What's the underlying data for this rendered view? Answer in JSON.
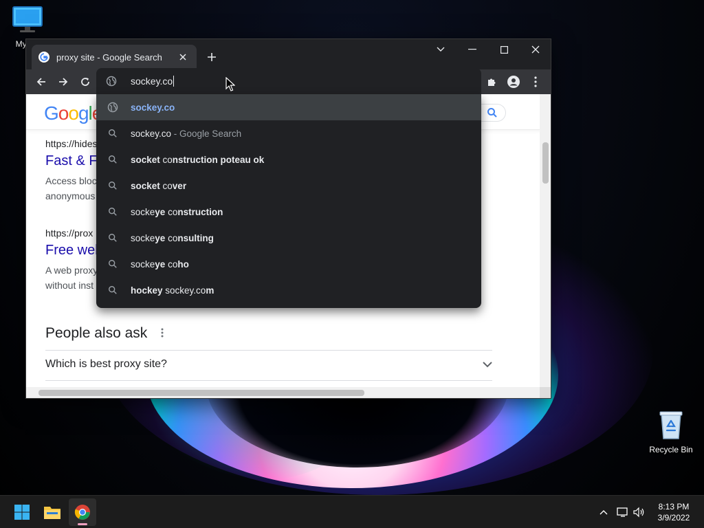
{
  "desktop": {
    "icons": [
      {
        "label": "My Co"
      },
      {
        "label": "Recycle Bin"
      }
    ]
  },
  "browser": {
    "tab": {
      "title": "proxy site - Google Search"
    },
    "omnibox": {
      "typed": "sockey.co"
    },
    "suggestions": [
      {
        "type": "url",
        "parts": [
          {
            "text": "sockey.co",
            "style": "link"
          }
        ]
      },
      {
        "type": "search",
        "parts": [
          {
            "text": "sockey.co",
            "style": "plain"
          },
          {
            "text": " - Google Search",
            "style": "dim"
          }
        ]
      },
      {
        "type": "search",
        "parts": [
          {
            "text": "socket",
            "style": "bold"
          },
          {
            "text": " co",
            "style": "plain"
          },
          {
            "text": "nstruction poteau ok",
            "style": "bold"
          }
        ]
      },
      {
        "type": "search",
        "parts": [
          {
            "text": "socket",
            "style": "bold"
          },
          {
            "text": " co",
            "style": "plain"
          },
          {
            "text": "ver",
            "style": "bold"
          }
        ]
      },
      {
        "type": "search",
        "parts": [
          {
            "text": "socke",
            "style": "plain"
          },
          {
            "text": "ye",
            "style": "bold"
          },
          {
            "text": " co",
            "style": "plain"
          },
          {
            "text": "nstruction",
            "style": "bold"
          }
        ]
      },
      {
        "type": "search",
        "parts": [
          {
            "text": "socke",
            "style": "plain"
          },
          {
            "text": "ye",
            "style": "bold"
          },
          {
            "text": " co",
            "style": "plain"
          },
          {
            "text": "nsulting",
            "style": "bold"
          }
        ]
      },
      {
        "type": "search",
        "parts": [
          {
            "text": "socke",
            "style": "plain"
          },
          {
            "text": "ye",
            "style": "bold"
          },
          {
            "text": " co",
            "style": "plain"
          },
          {
            "text": "ho",
            "style": "bold"
          }
        ]
      },
      {
        "type": "search",
        "parts": [
          {
            "text": "hockey",
            "style": "bold"
          },
          {
            "text": " sockey.co",
            "style": "plain"
          },
          {
            "text": "m",
            "style": "bold"
          }
        ]
      }
    ]
  },
  "page": {
    "logo": "Google",
    "results": [
      {
        "url": "https://hides",
        "title": "Fast & Fr",
        "snippet_lines": [
          "Access bloc",
          "anonymous"
        ]
      },
      {
        "url": "https://prox",
        "title": "Free web",
        "snippet_lines": [
          "A web proxy",
          "without inst"
        ]
      }
    ],
    "paa": {
      "title": "People also ask",
      "questions": [
        "Which is best proxy site?"
      ]
    }
  },
  "taskbar": {
    "clock": {
      "time": "8:13 PM",
      "date": "3/9/2022"
    }
  },
  "colors": {
    "chrome_dark": "#202124",
    "chrome_toolbar": "#35363a",
    "link_blue": "#8ab4f8",
    "result_title": "#1a0dab"
  }
}
